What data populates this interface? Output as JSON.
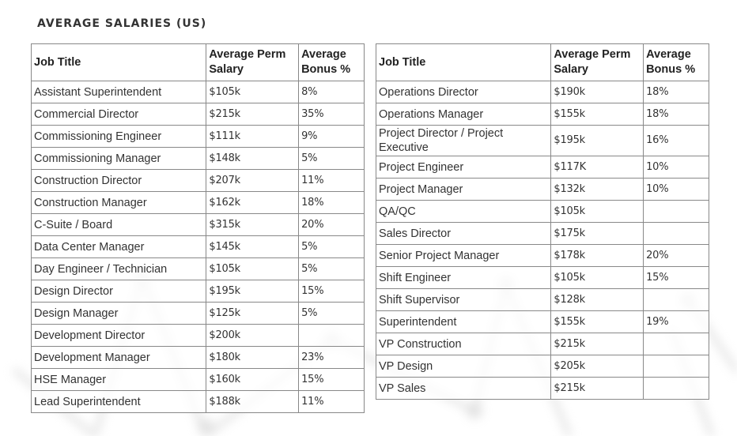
{
  "page_title": "AVERAGE SALARIES (US)",
  "columns": [
    "Job Title",
    "Average Perm Salary",
    "Average Bonus %"
  ],
  "left_table": [
    {
      "title": "Assistant Superintendent",
      "salary": "$105k",
      "bonus": "8%"
    },
    {
      "title": "Commercial Director",
      "salary": "$215k",
      "bonus": "35%"
    },
    {
      "title": "Commissioning Engineer",
      "salary": "$111k",
      "bonus": "9%"
    },
    {
      "title": "Commissioning Manager",
      "salary": "$148k",
      "bonus": "5%"
    },
    {
      "title": "Construction Director",
      "salary": "$207k",
      "bonus": "11%"
    },
    {
      "title": "Construction Manager",
      "salary": "$162k",
      "bonus": "18%"
    },
    {
      "title": "C-Suite / Board",
      "salary": "$315k",
      "bonus": "20%"
    },
    {
      "title": "Data Center Manager",
      "salary": "$145k",
      "bonus": "5%"
    },
    {
      "title": "Day Engineer / Technician",
      "salary": "$105k",
      "bonus": "5%"
    },
    {
      "title": "Design Director",
      "salary": "$195k",
      "bonus": "15%"
    },
    {
      "title": "Design Manager",
      "salary": "$125k",
      "bonus": "5%"
    },
    {
      "title": "Development Director",
      "salary": "$200k",
      "bonus": ""
    },
    {
      "title": "Development Manager",
      "salary": "$180k",
      "bonus": "23%"
    },
    {
      "title": "HSE Manager",
      "salary": "$160k",
      "bonus": "15%"
    },
    {
      "title": "Lead Superintendent",
      "salary": "$188k",
      "bonus": "11%"
    }
  ],
  "right_table": [
    {
      "title": "Operations Director",
      "salary": "$190k",
      "bonus": "18%"
    },
    {
      "title": "Operations Manager",
      "salary": "$155k",
      "bonus": "18%"
    },
    {
      "title": "Project Director / Project Executive",
      "salary": "$195k",
      "bonus": "16%"
    },
    {
      "title": "Project Engineer",
      "salary": "$117K",
      "bonus": "10%"
    },
    {
      "title": "Project Manager",
      "salary": "$132k",
      "bonus": "10%"
    },
    {
      "title": "QA/QC",
      "salary": "$105k",
      "bonus": ""
    },
    {
      "title": "Sales Director",
      "salary": "$175k",
      "bonus": ""
    },
    {
      "title": "Senior Project Manager",
      "salary": "$178k",
      "bonus": "20%"
    },
    {
      "title": "Shift Engineer",
      "salary": "$105k",
      "bonus": "15%"
    },
    {
      "title": "Shift Supervisor",
      "salary": "$128k",
      "bonus": ""
    },
    {
      "title": "Superintendent",
      "salary": "$155k",
      "bonus": "19%"
    },
    {
      "title": "VP Construction",
      "salary": "$215k",
      "bonus": ""
    },
    {
      "title": "VP Design",
      "salary": "$205k",
      "bonus": ""
    },
    {
      "title": "VP Sales",
      "salary": "$215k",
      "bonus": ""
    }
  ]
}
